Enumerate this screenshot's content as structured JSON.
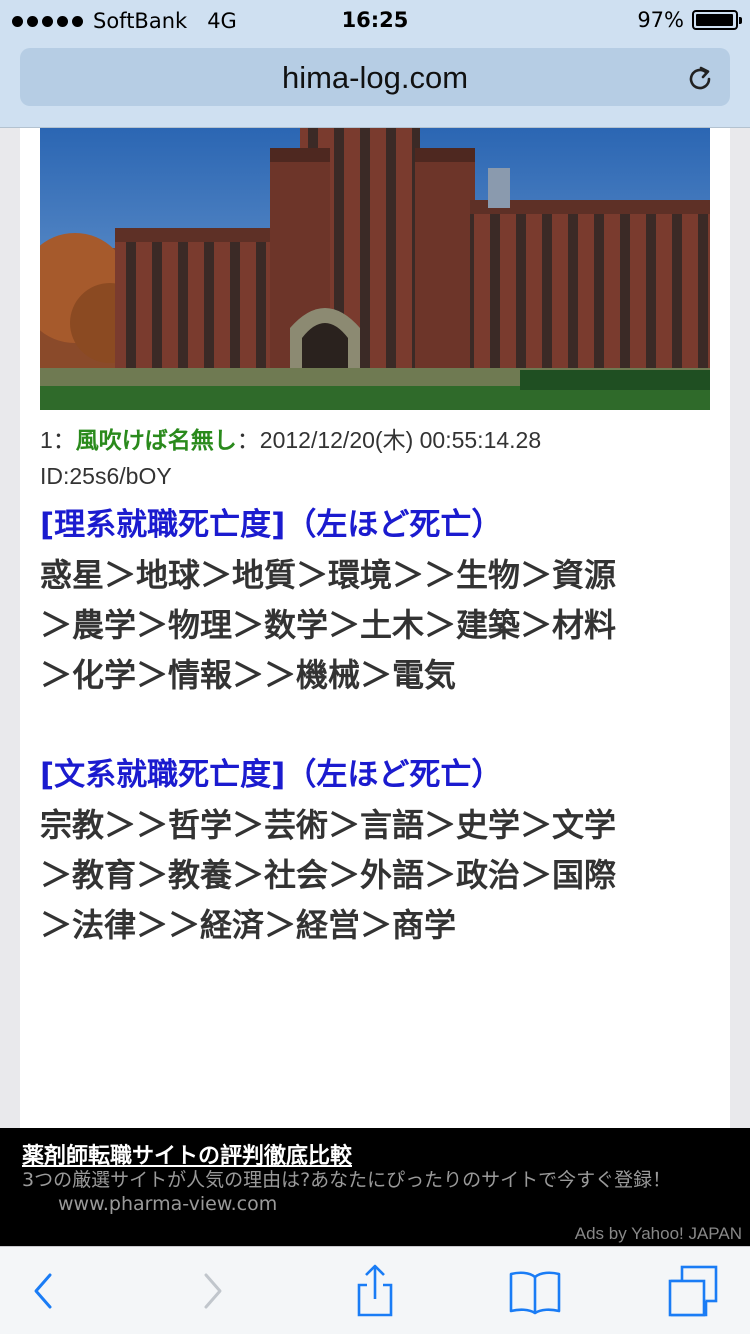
{
  "status_bar": {
    "carrier": "SoftBank",
    "network": "4G",
    "time": "16:25",
    "battery": "97%",
    "battery_level": 0.97
  },
  "browser": {
    "url": "hima-log.com"
  },
  "post": {
    "number": "1",
    "name": "風吹けば名無し",
    "datetime": "2012/12/20(木) 00:55:14.28",
    "id": "ID:25s6/bOY"
  },
  "science": {
    "heading": "[理系就職死亡度]（左ほど死亡）",
    "lines": [
      "惑星＞地球＞地質＞環境＞＞生物＞資源",
      "＞農学＞物理＞数学＞土木＞建築＞材料",
      "＞化学＞情報＞＞機械＞電気"
    ]
  },
  "humanities": {
    "heading": "[文系就職死亡度]（左ほど死亡）",
    "lines": [
      "宗教＞＞哲学＞芸術＞言語＞史学＞文学",
      "＞教育＞教養＞社会＞外語＞政治＞国際",
      "＞法律＞＞経済＞経営＞商学"
    ]
  },
  "ad": {
    "title": "薬剤師転職サイトの評判徹底比較",
    "description": "3つの厳選サイトが人気の理由は?あなたにぴったりのサイトで今すぐ登録！",
    "url": "www.pharma-view.com",
    "credit": "Ads by Yahoo! JAPAN"
  },
  "toolbar": {
    "icons": [
      "back-icon",
      "forward-icon",
      "share-icon",
      "bookmarks-icon",
      "tabs-icon"
    ]
  },
  "colors": {
    "chrome": "#cfe0f1",
    "link_blue": "#1b1bcf",
    "name_green": "#2a8a1c",
    "ios_blue": "#1a7cf5"
  }
}
